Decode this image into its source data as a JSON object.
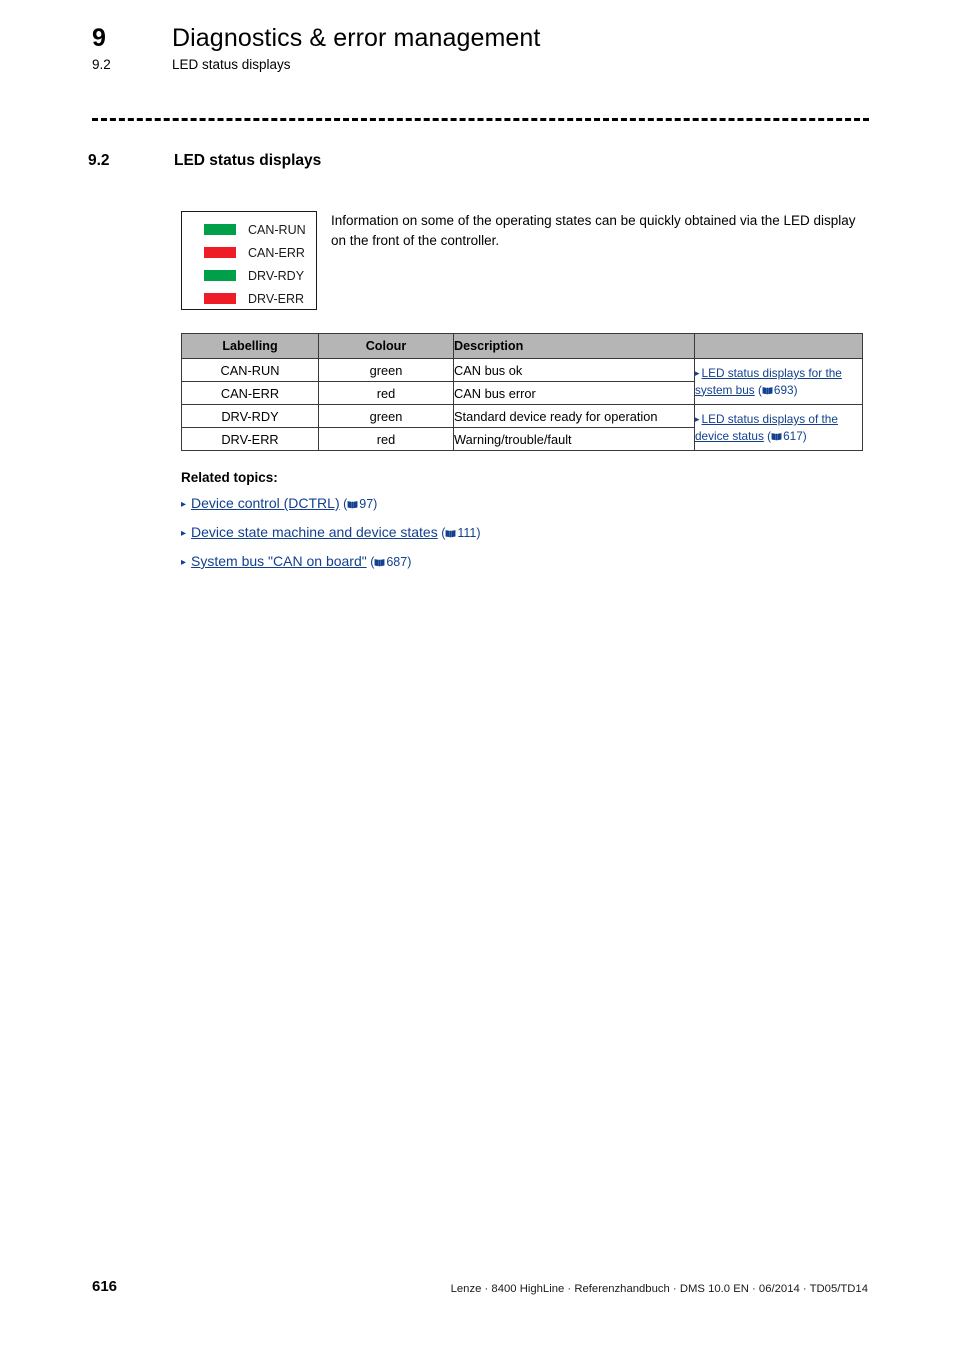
{
  "running_head": {
    "chapter_number": "9",
    "chapter_title": "Diagnostics & error management",
    "section_number": "9.2",
    "section_title": "LED status displays"
  },
  "section": {
    "number": "9.2",
    "title": "LED status displays"
  },
  "legend": {
    "items": [
      {
        "label": "CAN-RUN",
        "color": "#00A04B"
      },
      {
        "label": "CAN-ERR",
        "color": "#EE1C25"
      },
      {
        "label": "DRV-RDY",
        "color": "#00A04B"
      },
      {
        "label": "DRV-ERR",
        "color": "#EE1C25"
      }
    ]
  },
  "intro": {
    "text": "Information on some of the operating states can be quickly obtained via the LED display on the front of the controller."
  },
  "table": {
    "headers": {
      "labelling": "Labelling",
      "colour": "Colour",
      "description": "Description",
      "xref": ""
    },
    "rows": [
      {
        "labelling": "CAN-RUN",
        "colour": "green",
        "description": "CAN bus ok"
      },
      {
        "labelling": "CAN-ERR",
        "colour": "red",
        "description": "CAN bus error"
      },
      {
        "labelling": "DRV-RDY",
        "colour": "green",
        "description": "Standard device ready for operation"
      },
      {
        "labelling": "DRV-ERR",
        "colour": "red",
        "description": "Warning/trouble/fault"
      }
    ],
    "xrefs": [
      {
        "link_text": "LED status displays for the system bus",
        "page": "693"
      },
      {
        "link_text": "LED status displays of the device status",
        "page": "617"
      }
    ]
  },
  "related_topics": {
    "title": "Related topics:",
    "items": [
      {
        "link_text": "Device control (DCTRL)",
        "page": "97"
      },
      {
        "link_text": "Device state machine and device states",
        "page": "111"
      },
      {
        "link_text": "System bus \"CAN on board\"",
        "page": "687"
      }
    ]
  },
  "footer": {
    "page_number": "616",
    "imprint": "Lenze · 8400 HighLine · Referenzhandbuch · DMS 10.0 EN · 06/2014 · TD05/TD14"
  },
  "colors": {
    "led_green": "#00A04B",
    "led_red": "#EE1C25",
    "link_blue": "#12408F",
    "table_header_gray": "#B5B5B5"
  }
}
